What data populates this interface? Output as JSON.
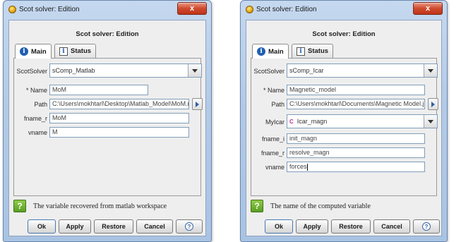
{
  "dialog1": {
    "window_title": "Scot solver: Edition",
    "close_label": "x",
    "header_title": "Scot solver: Edition",
    "tabs": [
      {
        "label": "Main"
      },
      {
        "label": "Status"
      }
    ],
    "fields": {
      "scot_solver": {
        "label": "ScotSolver",
        "value": "sComp_Matlab"
      },
      "name": {
        "label": "* Name",
        "value": "MoM"
      },
      "path": {
        "label": "Path",
        "value": "C:\\Users\\mokhtarl\\Desktop\\Matlab_Model\\MoM.mat"
      },
      "fname_r": {
        "label": "fname_r",
        "value": "MoM"
      },
      "vname": {
        "label": "vname",
        "value": "M"
      }
    },
    "help_text": "The variable recovered from matlab workspace",
    "buttons": {
      "ok": "Ok",
      "apply": "Apply",
      "restore": "Restore",
      "cancel": "Cancel"
    }
  },
  "dialog2": {
    "window_title": "Scot solver: Edition",
    "close_label": "x",
    "header_title": "Scot solver: Edition",
    "tabs": [
      {
        "label": "Main"
      },
      {
        "label": "Status"
      }
    ],
    "fields": {
      "scot_solver": {
        "label": "ScotSolver",
        "value": "sComp_Icar"
      },
      "name": {
        "label": "* Name",
        "value": "Magnetic_model"
      },
      "path": {
        "label": "Path",
        "value": "C:\\Users\\mokhtarl\\Documents\\Magnetic Model.java"
      },
      "my_icar": {
        "label": "MyIcar",
        "value": "Icar_magn"
      },
      "fname_i": {
        "label": "fname_i",
        "value": "init_magn"
      },
      "fname_r": {
        "label": "fname_r",
        "value": "resolve_magn"
      },
      "vname": {
        "label": "vname",
        "value": "forces"
      }
    },
    "help_text": "The name of the computed variable",
    "buttons": {
      "ok": "Ok",
      "apply": "Apply",
      "restore": "Restore",
      "cancel": "Cancel"
    }
  },
  "icons": {
    "app": "sun-icon",
    "main_tab": "info-icon",
    "status_tab": "status-info-icon",
    "help": "question-icon",
    "help_button": "help-circle-icon"
  },
  "colors": {
    "accent": "#1f5fb0",
    "close_button": "#cf4a2f",
    "help_icon": "#6aaa2e"
  }
}
